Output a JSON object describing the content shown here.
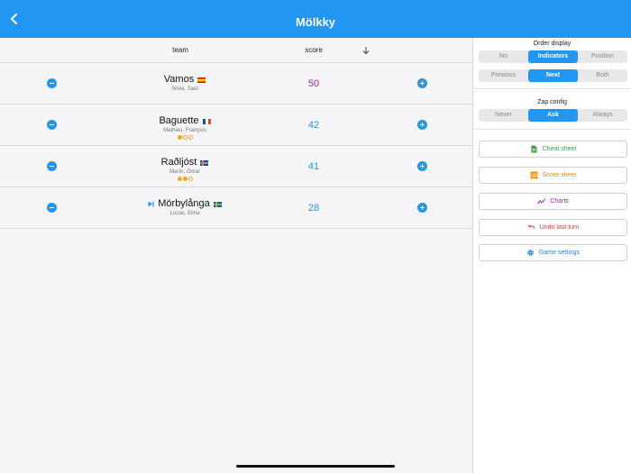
{
  "app": {
    "title": "Mölkky"
  },
  "colors": {
    "accent": "#2196f3",
    "purple": "#9c27b0",
    "green": "#43a047",
    "orange": "#fb8c00",
    "red": "#e53935"
  },
  "table": {
    "headers": {
      "team": "team",
      "score": "score"
    },
    "rows": [
      {
        "name": "Vamos",
        "flag": "es",
        "players": "Silvia, Saúl",
        "score": "50",
        "score_color": "#9c27b0",
        "dots": [],
        "current": false
      },
      {
        "name": "Baguette",
        "flag": "fr",
        "players": "Mathieu, François",
        "score": "42",
        "score_color": "#2196f3",
        "dots": [
          true,
          false,
          false
        ],
        "current": false
      },
      {
        "name": "Raðljóst",
        "flag": "is",
        "players": "Marín, Ómar",
        "score": "41",
        "score_color": "#2196f3",
        "dots": [
          true,
          true,
          false
        ],
        "current": false
      },
      {
        "name": "Mörbylånga",
        "flag": "se",
        "players": "Lucas, Elina",
        "score": "28",
        "score_color": "#2196f3",
        "dots": [],
        "current": true
      }
    ]
  },
  "sidebar": {
    "order_display": {
      "title": "Order display",
      "options_a": [
        "No",
        "Indicators",
        "Position"
      ],
      "selected_a": "Indicators",
      "options_b": [
        "Previous",
        "Next",
        "Both"
      ],
      "selected_b": "Next"
    },
    "zap_config": {
      "title": "Zap config",
      "options": [
        "Never",
        "Ask",
        "Always"
      ],
      "selected": "Ask"
    },
    "buttons": {
      "cheat_sheet": "Cheat sheet",
      "score_sheet": "Score sheet",
      "charts": "Charts",
      "undo": "Undo last turn",
      "settings": "Game settings"
    }
  }
}
